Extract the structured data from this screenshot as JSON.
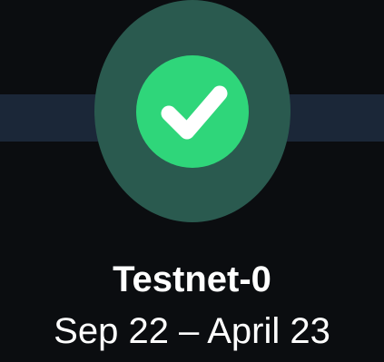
{
  "milestone": {
    "status_icon": "checkmark-icon",
    "title": "Testnet-0",
    "dates": "Sep 22 – April 23"
  },
  "colors": {
    "background": "#0b0d10",
    "timeline_bar": "#1b2738",
    "ring": "#2a5a4f",
    "check_fill": "#2fd67a",
    "check_mark": "#ffffff",
    "text": "#ffffff"
  }
}
